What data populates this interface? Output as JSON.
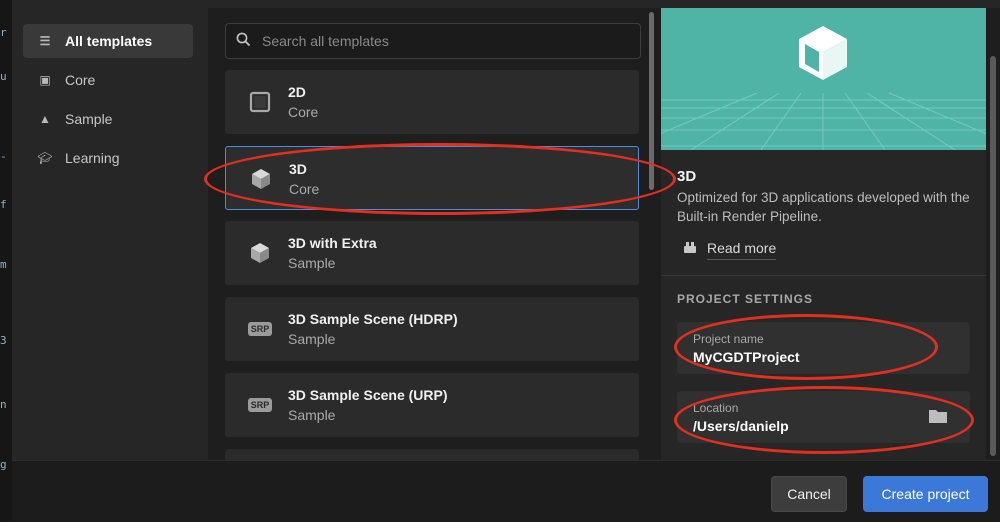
{
  "sidebar": {
    "items": [
      {
        "label": "All templates",
        "icon": "list-icon",
        "active": true
      },
      {
        "label": "Core",
        "icon": "core-icon",
        "active": false
      },
      {
        "label": "Sample",
        "icon": "sample-icon",
        "active": false
      },
      {
        "label": "Learning",
        "icon": "graduation-cap-icon",
        "active": false
      }
    ]
  },
  "search": {
    "placeholder": "Search all templates",
    "icon": "search-icon"
  },
  "templates": [
    {
      "name": "2D",
      "category": "Core",
      "icon": "square-icon",
      "selected": false
    },
    {
      "name": "3D",
      "category": "Core",
      "icon": "cube-icon",
      "selected": true
    },
    {
      "name": "3D with Extra",
      "category": "Sample",
      "icon": "cube-icon",
      "selected": false
    },
    {
      "name": "3D Sample Scene (HDRP)",
      "category": "Sample",
      "icon": "srp-icon",
      "badge": "SRP",
      "selected": false
    },
    {
      "name": "3D Sample Scene (URP)",
      "category": "Sample",
      "icon": "srp-icon",
      "badge": "SRP",
      "selected": false
    }
  ],
  "detail": {
    "title": "3D",
    "description": "Optimized for 3D applications developed with the Built-in Render Pipeline.",
    "read_more": "Read more",
    "settings_title": "PROJECT SETTINGS",
    "project_name_label": "Project name",
    "project_name_value": "MyCGDTProject",
    "location_label": "Location",
    "location_value": "/Users/danielp"
  },
  "footer": {
    "cancel": "Cancel",
    "create": "Create project"
  },
  "colors": {
    "accent": "#3b78d8",
    "selection_border": "#4a8be0",
    "preview_bg": "#4fb3a6",
    "annotation": "#e2301f"
  }
}
